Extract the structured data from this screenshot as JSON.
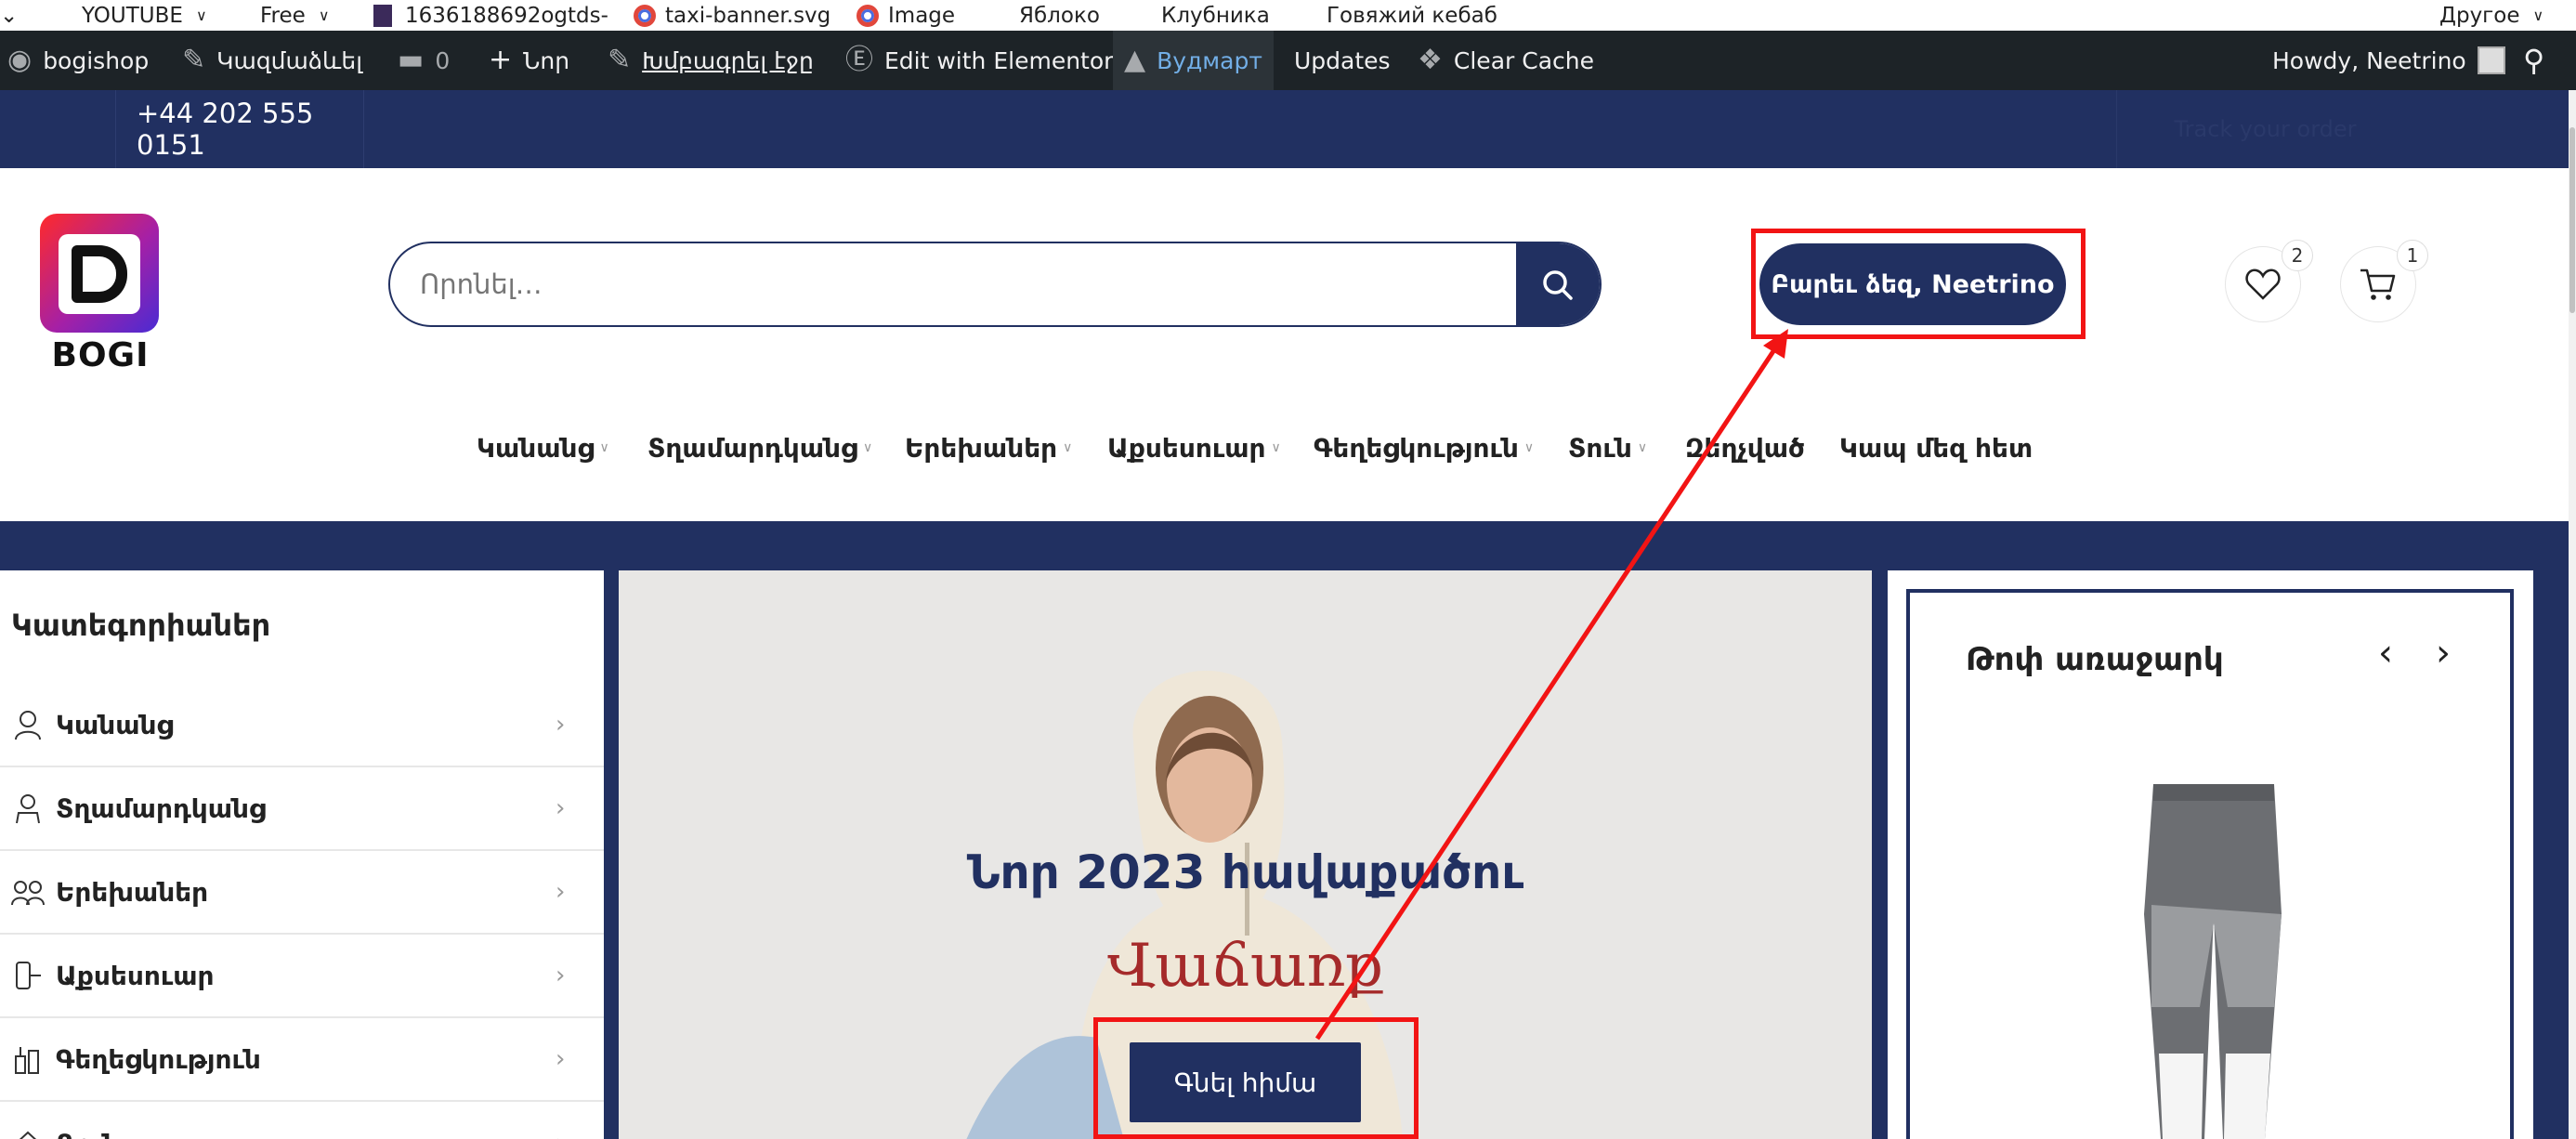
{
  "bookmarks": [
    {
      "label": "YOUTUBE",
      "dropdown": true
    },
    {
      "label": "Free",
      "dropdown": true
    },
    {
      "label": "1636188692ogtds-",
      "dropdown": false
    },
    {
      "label": "taxi-banner.svg",
      "dropdown": false
    },
    {
      "label": "Image",
      "dropdown": false
    },
    {
      "label": "Яблоко",
      "dropdown": false
    },
    {
      "label": "Клубника",
      "dropdown": false
    },
    {
      "label": "Говяжий кебаб",
      "dropdown": false
    }
  ],
  "bookmarks_other": "Другое",
  "admin_bar": {
    "site": "bogishop",
    "customize": "Կազմաձևել",
    "comments_count": "0",
    "new": "Նոր",
    "edit_page": "Խմբագրել էջը",
    "elementor": "Edit with Elementor",
    "woodmart": "Вудмарт",
    "updates": "Updates",
    "clear_cache": "Clear Cache",
    "howdy": "Howdy, Neetrino"
  },
  "top_strip": {
    "phone": "+44 202 555 0151",
    "right_text": "Track your order"
  },
  "header": {
    "brand": "BOGI",
    "search_placeholder": "Որոնել…",
    "welcome": "Բարեւ ձեզ, Neetrino",
    "wishlist_count": "2",
    "cart_count": "1"
  },
  "nav": [
    {
      "label": "Կանանց",
      "dropdown": true
    },
    {
      "label": "Տղամարդկանց",
      "dropdown": true
    },
    {
      "label": "Երեխաներ",
      "dropdown": true
    },
    {
      "label": "Աքսեսուար",
      "dropdown": true
    },
    {
      "label": "Գեղեցկություն",
      "dropdown": true
    },
    {
      "label": "Տուն",
      "dropdown": true
    },
    {
      "label": "Զեղչված",
      "dropdown": false
    },
    {
      "label": "Կապ մեզ հետ",
      "dropdown": false
    }
  ],
  "categories": {
    "title": "Կատեգորիաներ",
    "items": [
      "Կանանց",
      "Տղամարդկանց",
      "Երեխաներ",
      "Աքսեսուար",
      "Գեղեցկություն",
      "Տուն"
    ]
  },
  "hero": {
    "title": "Նոր 2023 հավաքածու",
    "subtitle": "Վաճառք",
    "button": "Գնել հիմա"
  },
  "offer": {
    "title": "Թոփ առաջարկ"
  },
  "colors": {
    "brand": "#213061",
    "annotation": "#f21414",
    "sale": "#a52a2a"
  }
}
